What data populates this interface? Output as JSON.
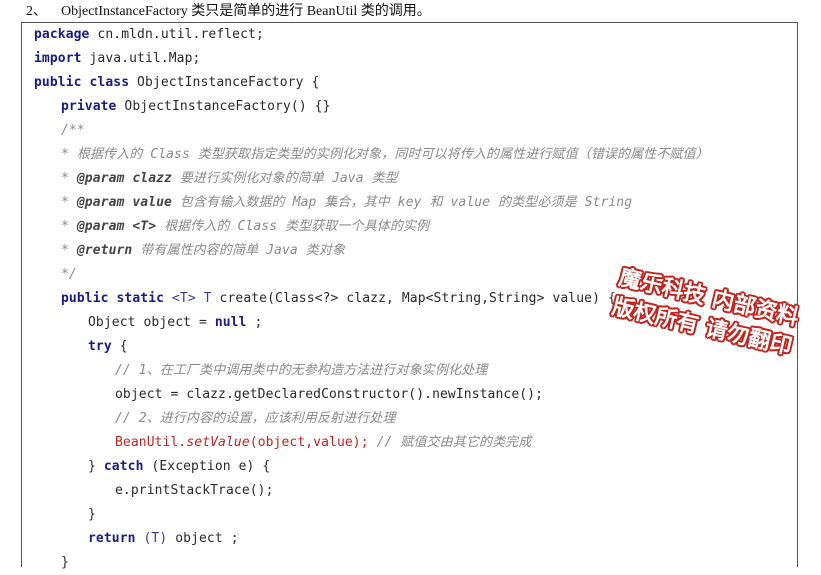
{
  "heading": {
    "number": "2、",
    "text": "ObjectInstanceFactory 类只是简单的进行 BeanUtil 类的调用。"
  },
  "code": {
    "l1_kw": "package",
    "l1_rest": " cn.mldn.util.reflect;",
    "l2_kw": "import",
    "l2_rest": " java.util.Map;",
    "l3_kw": "public class",
    "l3_rest": " ObjectInstanceFactory {",
    "l4_kw": "private",
    "l4_rest": " ObjectInstanceFactory() {}",
    "l5_comment": "/**",
    "l6_comment": "* 根据传入的 Class 类型获取指定类型的实例化对象，同时可以将传入的属性进行赋值（错误的属性不赋值）",
    "l7_star": "* ",
    "l7_tag": "@param clazz",
    "l7_text": " 要进行实例化对象的简单 Java 类型",
    "l8_star": "* ",
    "l8_tag": "@param value",
    "l8_text": " 包含有输入数据的 Map 集合，其中 key 和 value 的类型必须是 String",
    "l9_star": "* ",
    "l9_tag": "@param <T>",
    "l9_text": " 根据传入的 Class 类型获取一个具体的实例",
    "l10_star": "* ",
    "l10_tag": "@return",
    "l10_text": " 带有属性内容的简单 Java 类对象",
    "l11_comment": "*/",
    "l12_kw": "public static",
    "l12_tp": " <T> T",
    "l12_rest": " create(Class<?> clazz, Map<String,String> value) {",
    "l13_rest": "Object object = ",
    "l13_kw": "null",
    "l13_end": " ;",
    "l14_kw": "try",
    "l14_rest": " {",
    "l15_comment": "// 1、在工厂类中调用类中的无参构造方法进行对象实例化处理",
    "l16_rest": "object = clazz.getDeclaredConstructor().newInstance();",
    "l17_comment": "// 2、进行内容的设置，应该利用反射进行处理",
    "l18_red1": "BeanUtil.",
    "l18_red_it": "setValue",
    "l18_red2": "(object,value);",
    "l18_comment": " // 赋值交由其它的类完成",
    "l19_start": "} ",
    "l19_kw": "catch",
    "l19_rest": " (Exception e) {",
    "l20_rest": "e.printStackTrace();",
    "l21_rest": "}",
    "l22_kw": "return",
    "l22_tp": " (T)",
    "l22_rest": " object ;",
    "l23_rest": "}"
  },
  "watermark": {
    "line1": "魔乐科技 内部资料",
    "line2": "版权所有 请勿翻印"
  },
  "colors": {
    "keyword": "#1a1a8a",
    "comment": "#8a8a8a",
    "highlight_red": "#c3221f",
    "stamp_red": "#c0261f"
  }
}
